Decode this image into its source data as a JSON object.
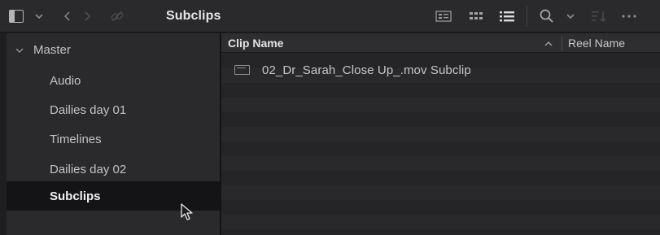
{
  "toolbar": {
    "title": "Subclips",
    "icons": [
      "panel-toggle-icon",
      "chevron-down-icon",
      "back-arrow-icon",
      "forward-arrow-icon",
      "link-icon",
      "filmstrip-view-icon",
      "thumbnail-view-icon",
      "list-view-icon",
      "search-icon",
      "chevron-down-icon",
      "sort-icon",
      "more-options-icon"
    ]
  },
  "sidebar": {
    "master_label": "Master",
    "items": [
      {
        "label": "Audio"
      },
      {
        "label": "Dailies day 01"
      },
      {
        "label": "Timelines"
      },
      {
        "label": "Dailies day 02"
      },
      {
        "label": "Subclips",
        "selected": true
      }
    ]
  },
  "table": {
    "columns": [
      "Clip Name",
      "Reel Name"
    ],
    "sorted_column": "Clip Name",
    "sort_direction": "ascending",
    "rows": [
      {
        "clip_name": "02_Dr_Sarah_Close Up_.mov Subclip",
        "reel_name": ""
      }
    ]
  },
  "colors": {
    "background": "#1e1e21",
    "panel": "#2a2a2d",
    "selected_row": "#141416",
    "text": "#c9c9cc",
    "text_bright": "#e6e6e8"
  }
}
